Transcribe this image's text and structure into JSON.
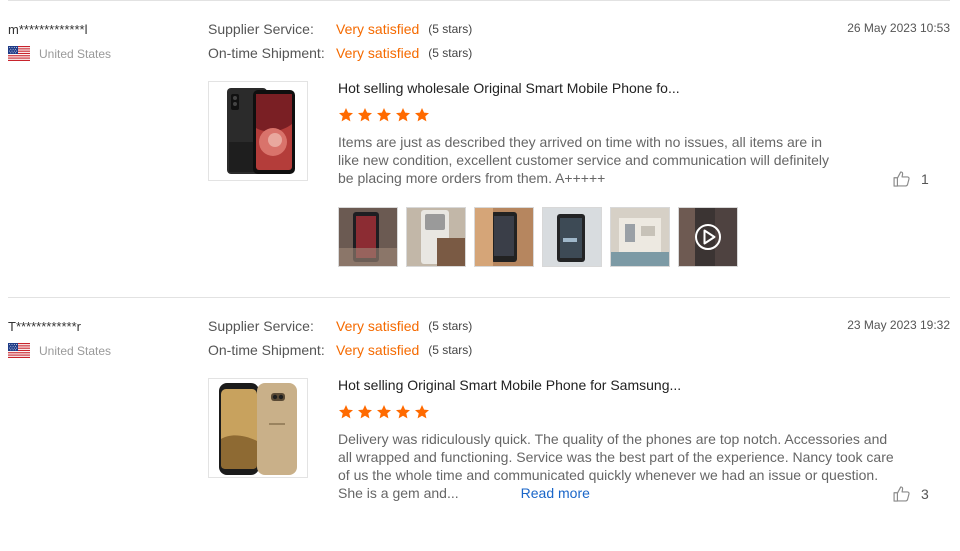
{
  "reviews": [
    {
      "user": "m*************l",
      "country": "United States",
      "flag": "us-flag-icon",
      "supplier_label": "Supplier Service:",
      "supplier_value": "Very satisfied",
      "supplier_stars": "(5 stars)",
      "shipment_label": "On-time Shipment:",
      "shipment_value": "Very satisfied",
      "shipment_stars": "(5 stars)",
      "date": "26 May 2023 10:53",
      "product_title": "Hot selling wholesale Original Smart Mobile Phone fo...",
      "product_image": "black-smartphone-image",
      "rating": 5,
      "text": "Items are just as described they arrived on time with no issues, all items are in like new condition, excellent customer service and communication will definitely be placing more orders from them. A+++++",
      "likes": "1",
      "photos": [
        "photo-1",
        "photo-2",
        "photo-3",
        "photo-4",
        "photo-5",
        "video-thumbnail"
      ]
    },
    {
      "user": "T************r",
      "country": "United States",
      "flag": "us-flag-icon",
      "supplier_label": "Supplier Service:",
      "supplier_value": "Very satisfied",
      "supplier_stars": "(5 stars)",
      "shipment_label": "On-time Shipment:",
      "shipment_value": "Very satisfied",
      "shipment_stars": "(5 stars)",
      "date": "23 May 2023 19:32",
      "product_title": "Hot selling Original Smart Mobile Phone for Samsung...",
      "product_image": "gold-smartphone-image",
      "rating": 5,
      "text": "Delivery was ridiculously quick. The quality of the phones are top notch. Accessories and all wrapped and functioning. Service was the best part of the experience. Nancy took care of us the whole time and communicated quickly whenever we had an issue or question. She is a gem and...",
      "read_more": "Read more",
      "likes": "3"
    }
  ],
  "colors": {
    "accent": "#f56a00",
    "star": "#ff6a00",
    "link": "#1a66c8"
  }
}
